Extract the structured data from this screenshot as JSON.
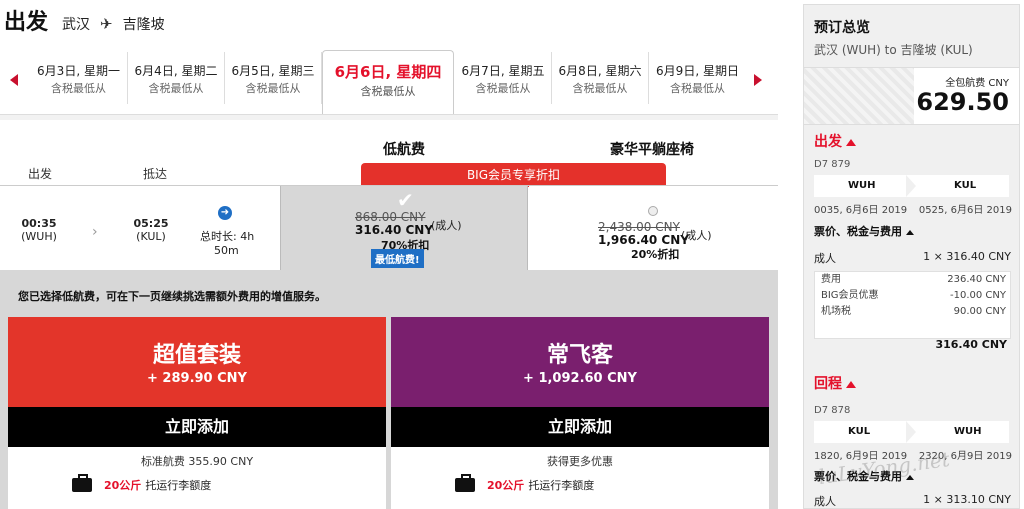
{
  "header": {
    "title": "出发",
    "origin": "武汉",
    "plane_icon": "plane-icon",
    "destination": "吉隆坡"
  },
  "date_tabs": [
    {
      "date": "6月3日, 星期一",
      "sub": "含税最低从"
    },
    {
      "date": "6月4日, 星期二",
      "sub": "含税最低从"
    },
    {
      "date": "6月5日, 星期三",
      "sub": "含税最低从"
    },
    {
      "date": "6月6日, 星期四",
      "sub": "含税最低从",
      "selected": true
    },
    {
      "date": "6月7日, 星期五",
      "sub": "含税最低从"
    },
    {
      "date": "6月8日, 星期六",
      "sub": "含税最低从"
    },
    {
      "date": "6月9日, 星期日",
      "sub": "含税最低从"
    }
  ],
  "fare_headers": {
    "low": "低航费",
    "premium": "豪华平躺座椅",
    "big_banner": "BIG会员专享折扣"
  },
  "columns": {
    "depart": "出发",
    "arrive": "抵达"
  },
  "flight": {
    "dep_time": "00:35",
    "dep_code": "(WUH)",
    "arr_time": "05:25",
    "arr_code": "(KUL)",
    "duration_label": "总时长: 4h",
    "duration_min": "50m"
  },
  "fare_low": {
    "orig": "868.00 CNY",
    "price": "316.40 CNY",
    "pax": "(成人)",
    "discount": "70%折扣",
    "tag": "最低航费!"
  },
  "fare_premium": {
    "orig": "2,438.00 CNY",
    "price": "1,966.40 CNY",
    "pax": "(成人)",
    "discount": "20%折扣"
  },
  "notice": "您已选择低航费，可在下一页继续挑选需额外费用的增值服务。",
  "packages": [
    {
      "name": "超值套装",
      "price": "+ 289.90 CNY",
      "button": "立即添加",
      "sub": "标准航费 355.90 CNY",
      "bag_kg": "20公斤",
      "bag_text": "托运行李额度",
      "color": "#e3352a"
    },
    {
      "name": "常飞客",
      "price": "+ 1,092.60 CNY",
      "button": "立即添加",
      "sub": "获得更多优惠",
      "bag_kg": "20公斤",
      "bag_text": "托运行李额度",
      "color": "#7a1f6e"
    }
  ],
  "summary": {
    "title": "预订总览",
    "route": "武汉 (WUH) to 吉隆坡 (KUL)",
    "total_label": "全包航费 CNY",
    "total": "629.50",
    "outbound": {
      "label": "出发",
      "flight_no": "D7 879",
      "from": "WUH",
      "to": "KUL",
      "dep": "0035, 6月6日 2019",
      "arr": "0525, 6月6日 2019",
      "price_section": "票价、税金与费用",
      "adult_label": "成人",
      "adult_value": "1 × 316.40 CNY",
      "fees": [
        {
          "name": "费用",
          "value": "236.40 CNY"
        },
        {
          "name": "BIG会员优惠",
          "value": "-10.00 CNY"
        },
        {
          "name": "机场税",
          "value": "90.00 CNY"
        }
      ],
      "subtotal": "316.40 CNY"
    },
    "return": {
      "label": "回程",
      "flight_no": "D7 878",
      "from": "KUL",
      "to": "WUH",
      "dep": "1820, 6月9日 2019",
      "arr": "2320, 6月9日 2019",
      "price_section": "票价、税金与费用",
      "adult_label": "成人",
      "adult_value": "1 × 313.10 CNY"
    }
  },
  "colors": {
    "accent_red": "#e4112b",
    "banner_red": "#e4312b",
    "info_blue": "#1f6fc5",
    "purple": "#7a1f6e"
  }
}
